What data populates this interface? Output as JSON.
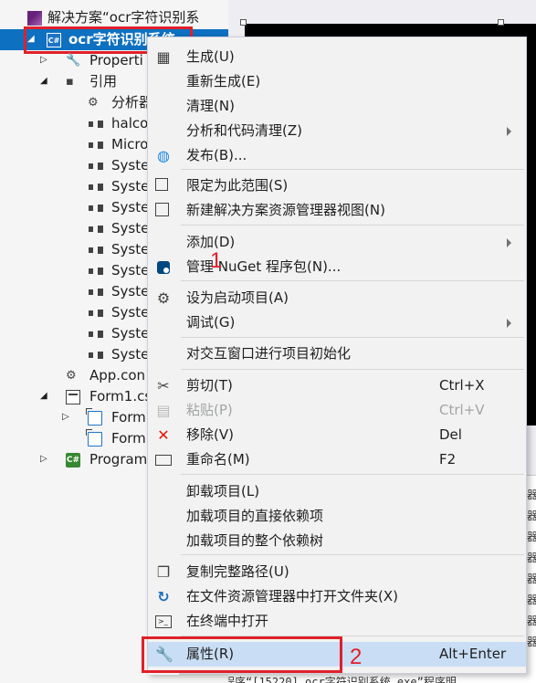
{
  "tree": {
    "solution": "解决方案“ocr字符识别系",
    "project": "ocr字符识别系统",
    "items": [
      {
        "label": "Properti",
        "icon": "wrench-icon",
        "indent": 1,
        "expander": "▷"
      },
      {
        "label": "引用",
        "icon": "references-icon",
        "indent": 1,
        "expander": "◢"
      },
      {
        "label": "分析器",
        "icon": "analyzer-icon",
        "indent": 2
      },
      {
        "label": "halco",
        "icon": "reference-icon",
        "indent": 2
      },
      {
        "label": "Micro",
        "icon": "reference-icon",
        "indent": 2
      },
      {
        "label": "Syste",
        "icon": "reference-icon",
        "indent": 2
      },
      {
        "label": "Syste",
        "icon": "reference-icon",
        "indent": 2
      },
      {
        "label": "Syste",
        "icon": "reference-icon",
        "indent": 2
      },
      {
        "label": "Syste",
        "icon": "reference-icon",
        "indent": 2
      },
      {
        "label": "Syste",
        "icon": "reference-icon",
        "indent": 2
      },
      {
        "label": "Syste",
        "icon": "reference-icon",
        "indent": 2
      },
      {
        "label": "Syste",
        "icon": "reference-icon",
        "indent": 2
      },
      {
        "label": "Syste",
        "icon": "reference-icon",
        "indent": 2
      },
      {
        "label": "Syste",
        "icon": "reference-icon",
        "indent": 2
      },
      {
        "label": "Syste",
        "icon": "reference-icon",
        "indent": 2
      },
      {
        "label": "App.con",
        "icon": "config-icon",
        "indent": 1
      },
      {
        "label": "Form1.cs",
        "icon": "form-icon",
        "indent": 1,
        "expander": "◢"
      },
      {
        "label": "Form",
        "icon": "resource-icon",
        "indent": 2,
        "expander": "▷"
      },
      {
        "label": "Form",
        "icon": "resource-icon",
        "indent": 2
      },
      {
        "label": "Program",
        "icon": "csharp-file-icon",
        "indent": 1,
        "expander": "▷"
      }
    ]
  },
  "menu": {
    "items": [
      {
        "label": "生成(U)",
        "icon": "build-icon"
      },
      {
        "label": "重新生成(E)"
      },
      {
        "label": "清理(N)"
      },
      {
        "label": "分析和代码清理(Z)",
        "submenu": true
      },
      {
        "label": "发布(B)...",
        "icon": "globe-icon"
      },
      {
        "label": "限定为此范围(S)",
        "icon": "scope-icon"
      },
      {
        "label": "新建解决方案资源管理器视图(N)",
        "icon": "new-view-icon"
      },
      {
        "label": "添加(D)",
        "submenu": true
      },
      {
        "label": "管理 NuGet 程序包(N)...",
        "icon": "nuget-icon"
      },
      {
        "label": "设为启动项目(A)",
        "icon": "gear-icon"
      },
      {
        "label": "调试(G)",
        "submenu": true
      },
      {
        "label": "对交互窗口进行项目初始化"
      },
      {
        "label": "剪切(T)",
        "shortcut": "Ctrl+X",
        "icon": "scissors-icon"
      },
      {
        "label": "粘贴(P)",
        "shortcut": "Ctrl+V",
        "icon": "paste-icon",
        "disabled": true
      },
      {
        "label": "移除(V)",
        "shortcut": "Del",
        "icon": "remove-icon"
      },
      {
        "label": "重命名(M)",
        "shortcut": "F2",
        "icon": "rename-icon"
      },
      {
        "label": "卸载项目(L)"
      },
      {
        "label": "加载项目的直接依赖项"
      },
      {
        "label": "加载项目的整个依赖树"
      },
      {
        "label": "复制完整路径(U)",
        "icon": "copy-icon"
      },
      {
        "label": "在文件资源管理器中打开文件夹(X)",
        "icon": "refresh-icon"
      },
      {
        "label": "在终端中打开",
        "icon": "terminal-icon"
      },
      {
        "label": "属性(R)",
        "shortcut": "Alt+Enter",
        "icon": "wrench-icon",
        "hot": true
      }
    ]
  },
  "annotations": {
    "one": "1",
    "two": "2"
  },
  "output": {
    "lines": [
      "器",
      "器",
      "器",
      "器",
      "器",
      "器",
      "器",
      "器"
    ],
    "bottom": "程序“[15220] ocr字符识别系统.exe”程序明"
  },
  "colors": {
    "selection": "#0e70c0",
    "highlight": "#e0202a",
    "menu_bg": "#f2f2f2",
    "menu_hot": "#c9def5"
  }
}
